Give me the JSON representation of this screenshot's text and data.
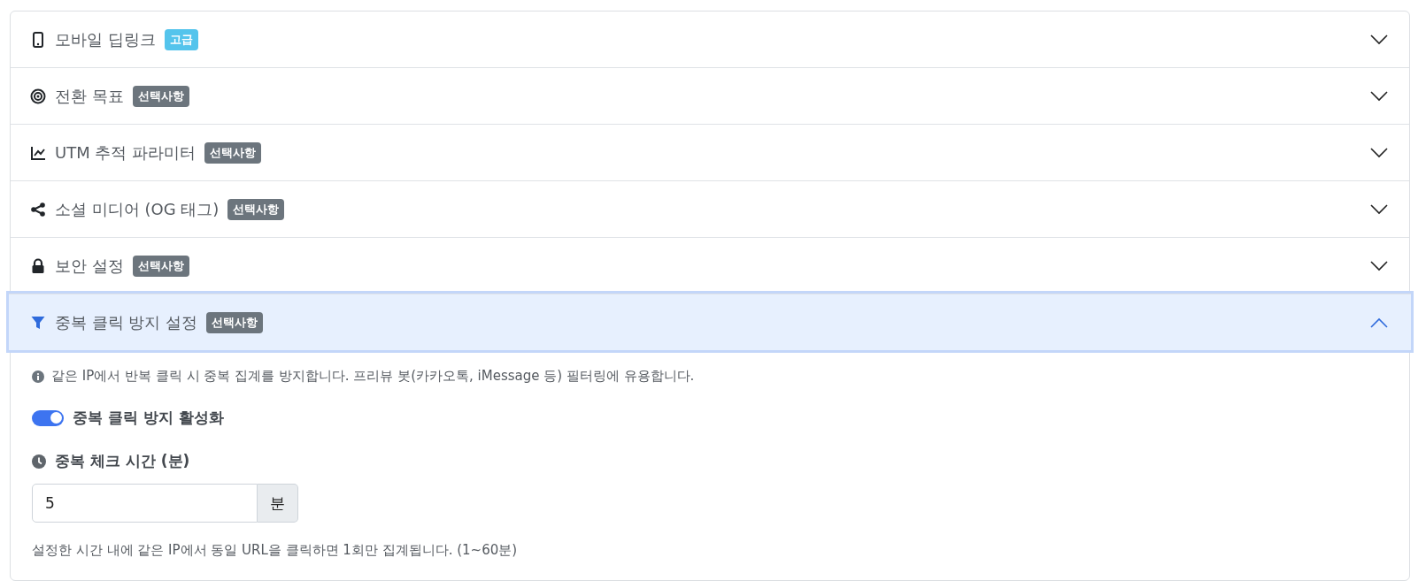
{
  "sections": [
    {
      "title": "모바일 딥링크",
      "badge": {
        "text": "고급",
        "kind": "info"
      },
      "expanded": false
    },
    {
      "title": "전환 목표",
      "badge": {
        "text": "선택사항",
        "kind": "secondary"
      },
      "expanded": false
    },
    {
      "title": "UTM 추적 파라미터",
      "badge": {
        "text": "선택사항",
        "kind": "secondary"
      },
      "expanded": false
    },
    {
      "title": "소셜 미디어 (OG 태그)",
      "badge": {
        "text": "선택사항",
        "kind": "secondary"
      },
      "expanded": false
    },
    {
      "title": "보안 설정",
      "badge": {
        "text": "선택사항",
        "kind": "secondary"
      },
      "expanded": false
    },
    {
      "title": "중복 클릭 방지 설정",
      "badge": {
        "text": "선택사항",
        "kind": "secondary"
      },
      "expanded": true,
      "body": {
        "info": "같은 IP에서 반복 클릭 시 중복 집계를 방지합니다. 프리뷰 봇(카카오톡, iMessage 등) 필터링에 유용합니다.",
        "toggle": {
          "label": "중복 클릭 방지 활성화",
          "on": true
        },
        "field": {
          "label": "중복 체크 시간 (분)",
          "value": "5",
          "unit": "분"
        },
        "help": "설정한 시간 내에 같은 IP에서 동일 URL을 클릭하면 1회만 집계됩니다. (1~60분)"
      }
    }
  ]
}
